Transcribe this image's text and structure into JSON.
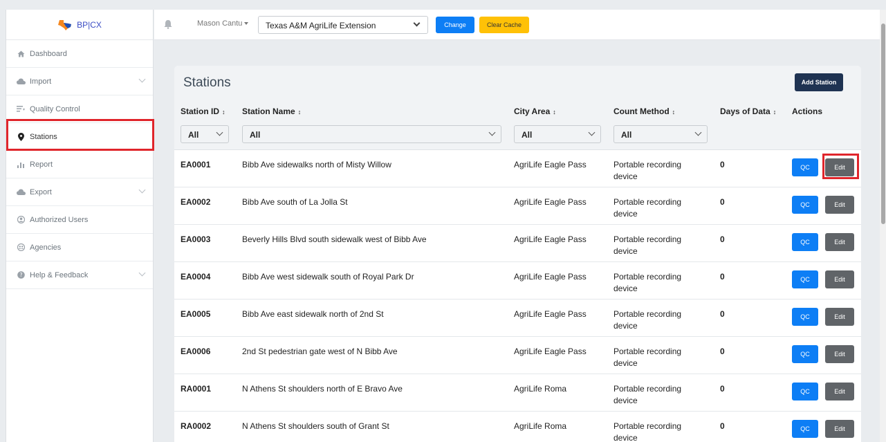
{
  "brand": {
    "text": "BP|CX"
  },
  "sidebar": {
    "items": [
      {
        "label": "Dashboard",
        "icon": "home-icon",
        "has_chevron": false
      },
      {
        "label": "Import",
        "icon": "cloud-upload-icon",
        "has_chevron": true
      },
      {
        "label": "Quality Control",
        "icon": "filter-list-icon",
        "has_chevron": false
      },
      {
        "label": "Stations",
        "icon": "map-marker-icon",
        "has_chevron": false,
        "active": true
      },
      {
        "label": "Report",
        "icon": "bar-chart-icon",
        "has_chevron": false
      },
      {
        "label": "Export",
        "icon": "cloud-download-icon",
        "has_chevron": true
      },
      {
        "label": "Authorized Users",
        "icon": "user-circle-icon",
        "has_chevron": false
      },
      {
        "label": "Agencies",
        "icon": "group-icon",
        "has_chevron": false
      },
      {
        "label": "Help & Feedback",
        "icon": "question-circle-icon",
        "has_chevron": true
      }
    ]
  },
  "topbar": {
    "user": "Mason Cantu",
    "organization": "Texas A&M AgriLife Extension",
    "change_label": "Change",
    "clear_cache_label": "Clear Cache"
  },
  "card": {
    "title": "Stations",
    "add_label": "Add Station"
  },
  "table": {
    "headers": {
      "station_id": "Station ID",
      "station_name": "Station Name",
      "city_area": "City Area",
      "count_method": "Count Method",
      "days": "Days of Data",
      "actions": "Actions"
    },
    "sort_glyph": "↕",
    "filters": {
      "station_id": "All",
      "station_name": "All",
      "city_area": "All",
      "count_method": "All"
    },
    "qc_label": "QC",
    "edit_label": "Edit",
    "rows": [
      {
        "id": "EA0001",
        "name": "Bibb Ave sidewalks north of Misty Willow",
        "area": "AgriLife Eagle Pass",
        "method": "Portable recording device",
        "days": "0"
      },
      {
        "id": "EA0002",
        "name": "Bibb Ave south of La Jolla St",
        "area": "AgriLife Eagle Pass",
        "method": "Portable recording device",
        "days": "0"
      },
      {
        "id": "EA0003",
        "name": "Beverly Hills Blvd south sidewalk west of Bibb Ave",
        "area": "AgriLife Eagle Pass",
        "method": "Portable recording device",
        "days": "0"
      },
      {
        "id": "EA0004",
        "name": "Bibb Ave west sidewalk south of Royal Park Dr",
        "area": "AgriLife Eagle Pass",
        "method": "Portable recording device",
        "days": "0"
      },
      {
        "id": "EA0005",
        "name": "Bibb Ave east sidewalk north of 2nd St",
        "area": "AgriLife Eagle Pass",
        "method": "Portable recording device",
        "days": "0"
      },
      {
        "id": "EA0006",
        "name": "2nd St pedestrian gate west of N Bibb Ave",
        "area": "AgriLife Eagle Pass",
        "method": "Portable recording device",
        "days": "0"
      },
      {
        "id": "RA0001",
        "name": "N Athens St shoulders north of E Bravo Ave",
        "area": "AgriLife Roma",
        "method": "Portable recording device",
        "days": "0"
      },
      {
        "id": "RA0002",
        "name": "N Athens St shoulders south of Grant St",
        "area": "AgriLife Roma",
        "method": "Portable recording device",
        "days": "0"
      }
    ]
  },
  "colors": {
    "primary": "#0d7ef5",
    "warning": "#ffc107",
    "dark": "#1f3352",
    "secondary": "#606468",
    "highlight": "#e0252b"
  }
}
